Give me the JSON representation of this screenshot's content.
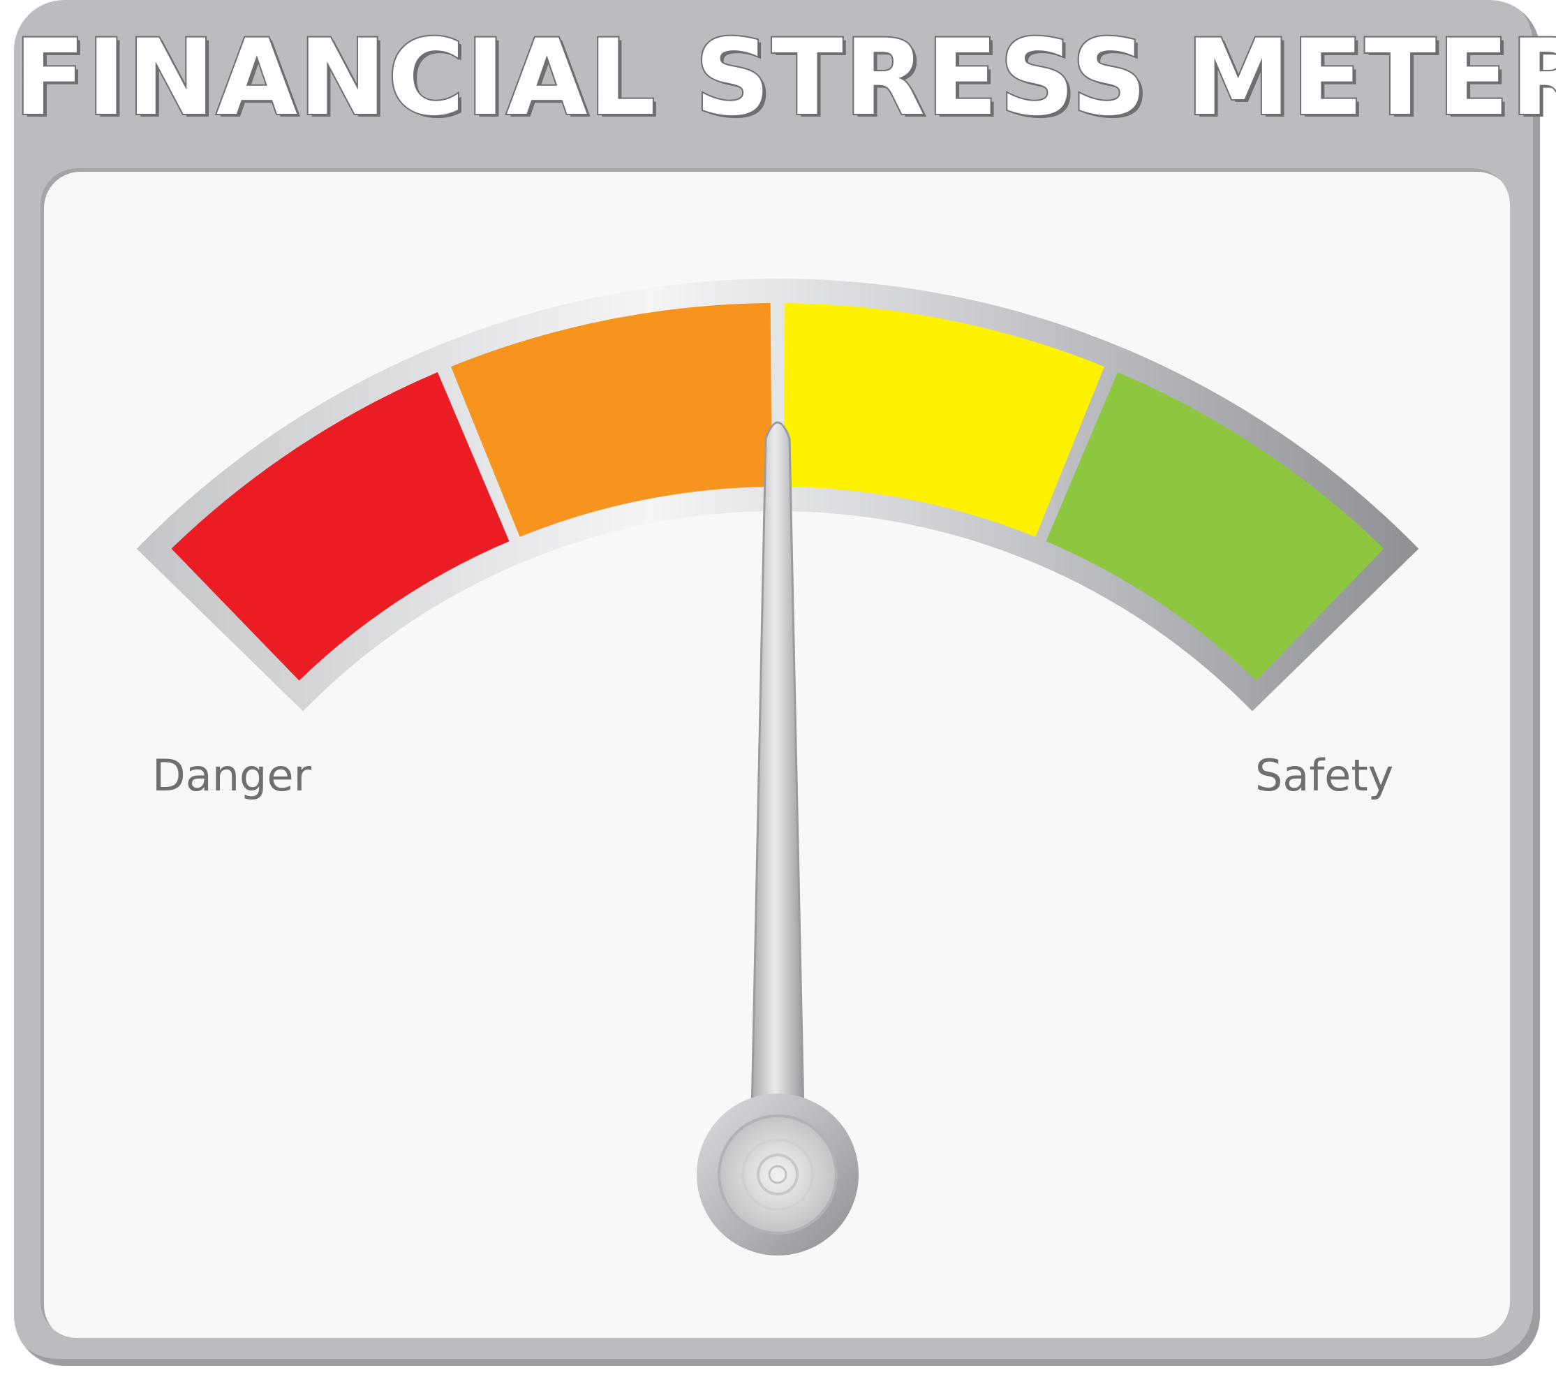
{
  "title": "FINANCIAL STRESS METER",
  "scale": {
    "low_label": "Danger",
    "high_label": "Safety"
  },
  "segments": [
    {
      "color": "#ec1c24"
    },
    {
      "color": "#f6941e"
    },
    {
      "color": "#fff200"
    },
    {
      "color": "#8dc63f"
    }
  ],
  "needle": {
    "level": 0.5
  },
  "colors": {
    "frame": "#bbbcbf",
    "face": "#f8f8fa",
    "text": "#6d6e71",
    "needle": "#d7d8da"
  }
}
